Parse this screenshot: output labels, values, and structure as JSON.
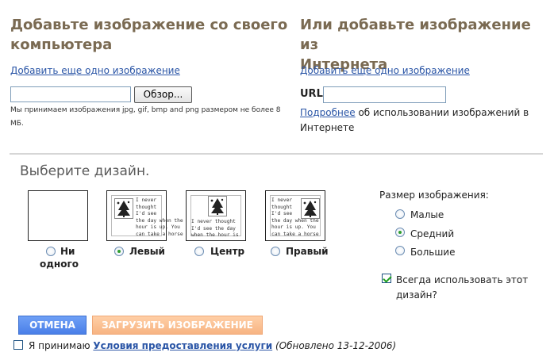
{
  "left": {
    "title_line1": "Добавьте изображение со своего",
    "title_line2": "компьютера",
    "add_another": "Добавить еще одно изображение",
    "file_value": "",
    "browse_label": "Обзор...",
    "note_line1": "Мы принимаем изображения jpg, gif, bmp and png размером не более 8",
    "note_line2": "МБ."
  },
  "right": {
    "title_line1": "Или добавьте изображение из",
    "title_line2": "Интернета",
    "add_another": "Добавить еще одно изображение",
    "url_label": "URL",
    "url_value": "",
    "more_link": "Подробнее",
    "more_text_line1": " об использовании изображений в",
    "more_text_line2": "Интернете"
  },
  "design": {
    "title": "Выберите дизайн.",
    "sample_text": "I never thought I'd see the day when the hour is up. You can take a horse",
    "options": [
      {
        "label_line1": "Ни",
        "label_line2": "одного",
        "selected": false
      },
      {
        "label": "Левый",
        "selected": true
      },
      {
        "label": "Центр",
        "selected": false
      },
      {
        "label": "Правый",
        "selected": false
      }
    ]
  },
  "size": {
    "title": "Размер изображения:",
    "options": [
      {
        "label": "Малые",
        "selected": false
      },
      {
        "label": "Средний",
        "selected": true
      },
      {
        "label": "Большие",
        "selected": false
      }
    ],
    "always_use_line1": "Всегда использовать этот",
    "always_use_line2": "дизайн?",
    "always_use_checked": true
  },
  "actions": {
    "cancel": "ОТМЕНА",
    "upload": "ЗАГРУЗИТЬ ИЗОБРАЖЕНИЕ"
  },
  "terms": {
    "prefix": "Я принимаю ",
    "link": "Условия предоставления услуги",
    "updated": "(Обновлено 13-12-2006)",
    "checked": false
  }
}
